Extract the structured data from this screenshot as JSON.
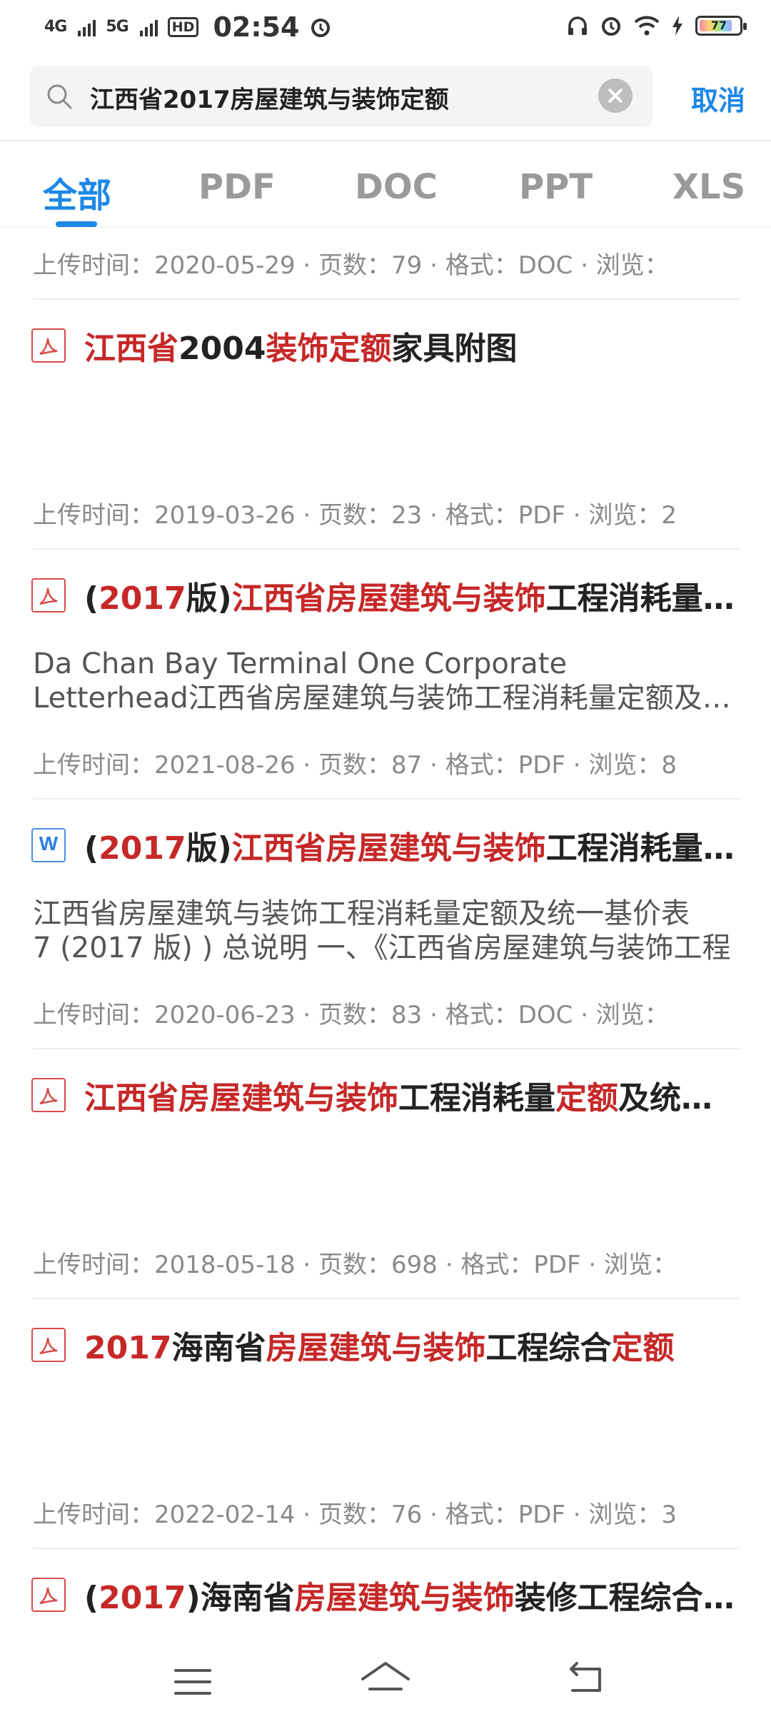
{
  "status_bar": {
    "network1": "4G",
    "network2": "5G",
    "hd": "HD",
    "time": "02:54",
    "battery": "77"
  },
  "search": {
    "query": "江西省2017房屋建筑与装饰定额",
    "cancel_label": "取消"
  },
  "tabs": [
    "全部",
    "PDF",
    "DOC",
    "PPT",
    "XLS"
  ],
  "results": [
    {
      "meta": "上传时间：2020-05-29 · 页数：79 · 格式：DOC · 浏览："
    },
    {
      "type": "pdf",
      "title_parts": [
        {
          "text": "江西省",
          "hl": true
        },
        {
          "text": "2004",
          "hl": false
        },
        {
          "text": "装饰定额",
          "hl": true
        },
        {
          "text": "家具附图",
          "hl": false
        }
      ],
      "desc": [],
      "meta": "上传时间：2019-03-26 · 页数：23 · 格式：PDF · 浏览：2"
    },
    {
      "type": "pdf",
      "title_parts": [
        {
          "text": "(",
          "hl": false
        },
        {
          "text": "2017",
          "hl": true
        },
        {
          "text": "版)",
          "hl": false
        },
        {
          "text": "江西省房屋建筑与装饰",
          "hl": true
        },
        {
          "text": "工程消耗量定额",
          "hl": false
        }
      ],
      "desc": [
        "Da Chan Bay Terminal One Corporate",
        "Letterhead江西省房屋建筑与装饰工程消耗量定额及统一基价表"
      ],
      "meta": "上传时间：2021-08-26 · 页数：87 · 格式：PDF · 浏览：8"
    },
    {
      "type": "doc",
      "title_parts": [
        {
          "text": "(",
          "hl": false
        },
        {
          "text": "2017",
          "hl": true
        },
        {
          "text": "版)",
          "hl": false
        },
        {
          "text": "江西省房屋建筑与装饰",
          "hl": true
        },
        {
          "text": "工程消耗量定额",
          "hl": false
        }
      ],
      "desc": [
        "江西省房屋建筑与装饰工程消耗量定额及统一基价表",
        "7 (2017 版) )  总说明  一、《江西省房屋建筑与装饰工程"
      ],
      "meta": "上传时间：2020-06-23 · 页数：83 · 格式：DOC · 浏览："
    },
    {
      "type": "pdf",
      "title_parts": [
        {
          "text": "江西省房屋建筑与装饰",
          "hl": true
        },
        {
          "text": "工程消耗量",
          "hl": false
        },
        {
          "text": "定额",
          "hl": true
        },
        {
          "text": "及统一基价表",
          "hl": false
        }
      ],
      "desc": [],
      "meta": "上传时间：2018-05-18 · 页数：698 · 格式：PDF · 浏览："
    },
    {
      "type": "pdf",
      "title_parts": [
        {
          "text": "2017",
          "hl": true
        },
        {
          "text": "海南省",
          "hl": false
        },
        {
          "text": "房屋建筑与装饰",
          "hl": true
        },
        {
          "text": "工程综合",
          "hl": false
        },
        {
          "text": "定额",
          "hl": true
        }
      ],
      "desc": [],
      "meta": "上传时间：2022-02-14 · 页数：76 · 格式：PDF · 浏览：3"
    },
    {
      "type": "pdf",
      "title_parts": [
        {
          "text": "(",
          "hl": false
        },
        {
          "text": "2017",
          "hl": true
        },
        {
          "text": ")海南省",
          "hl": false
        },
        {
          "text": "房屋建筑与装饰",
          "hl": true
        },
        {
          "text": "装修工程综合定额",
          "hl": false
        }
      ],
      "desc": [],
      "meta": ""
    }
  ]
}
